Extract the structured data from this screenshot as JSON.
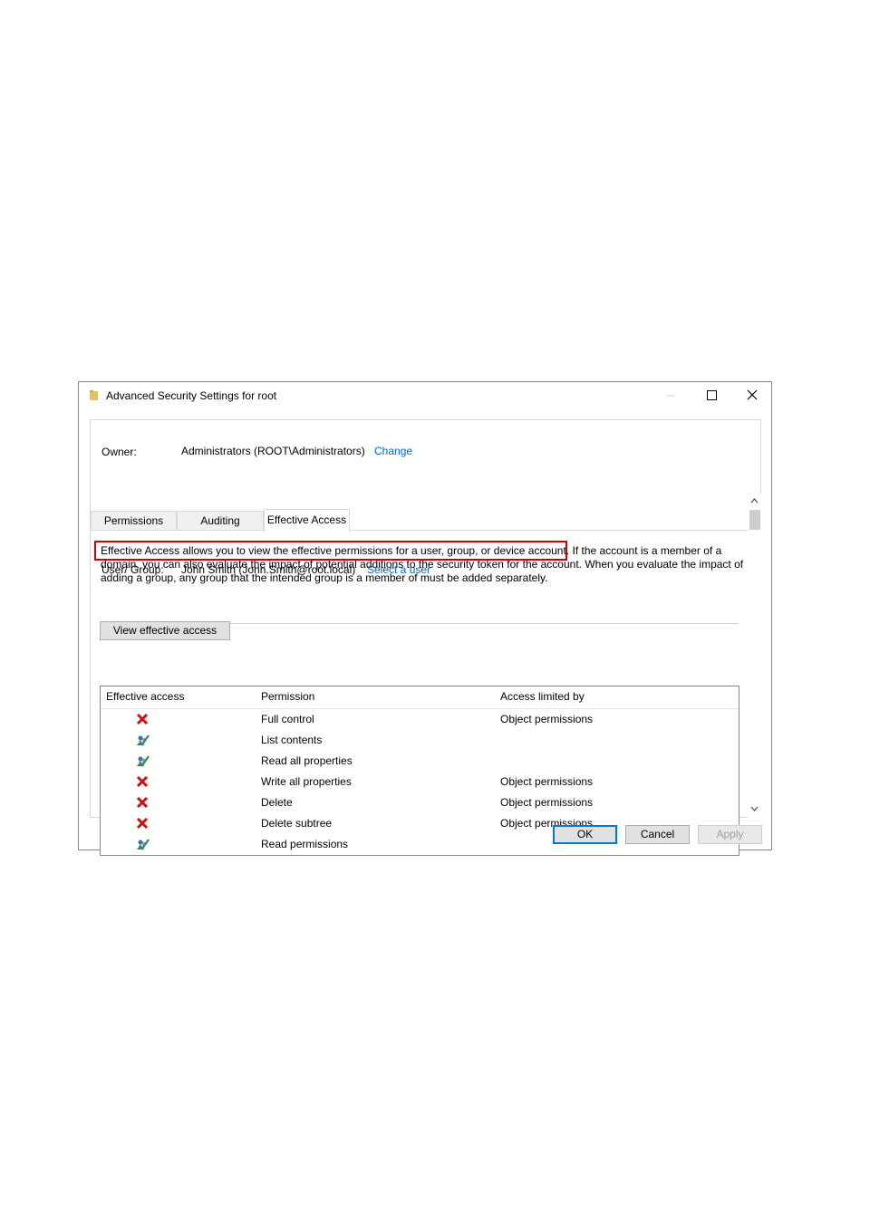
{
  "window": {
    "title": "Advanced Security Settings for root"
  },
  "owner": {
    "label": "Owner:",
    "value": "Administrators (ROOT\\Administrators)",
    "change_link": "Change"
  },
  "tabs": [
    {
      "label": "Permissions"
    },
    {
      "label": "Auditing"
    },
    {
      "label": "Effective Access"
    }
  ],
  "description": {
    "highlighted": "Effective Access allows you to view the effective permissions for a user, group, or device account.",
    "rest": " If the account is a member of a domain, you can also evaluate the impact of potential additions to the security token for the account. When you evaluate the impact of adding a group, any group that the intended group is a member of must be added separately."
  },
  "user_group": {
    "label": "User/ Group:",
    "value": "John Smith (John.Smith@root.local)",
    "select_link": "Select a user"
  },
  "view_button": "View effective access",
  "table": {
    "headers": [
      "Effective access",
      "Permission",
      "Access limited by"
    ],
    "rows": [
      {
        "access": "deny",
        "permission": "Full control",
        "limited_by": "Object permissions"
      },
      {
        "access": "allow",
        "permission": "List contents",
        "limited_by": ""
      },
      {
        "access": "allow",
        "permission": "Read all properties",
        "limited_by": ""
      },
      {
        "access": "deny",
        "permission": "Write all properties",
        "limited_by": "Object permissions"
      },
      {
        "access": "deny",
        "permission": "Delete",
        "limited_by": "Object permissions"
      },
      {
        "access": "deny",
        "permission": "Delete subtree",
        "limited_by": "Object permissions"
      },
      {
        "access": "allow",
        "permission": "Read permissions",
        "limited_by": ""
      }
    ]
  },
  "buttons": {
    "ok": "OK",
    "cancel": "Cancel",
    "apply": "Apply"
  },
  "colors": {
    "highlight": "#cc0000",
    "link": "#0066cc",
    "deny": "#d01010",
    "allow": "#3a8f3a"
  }
}
